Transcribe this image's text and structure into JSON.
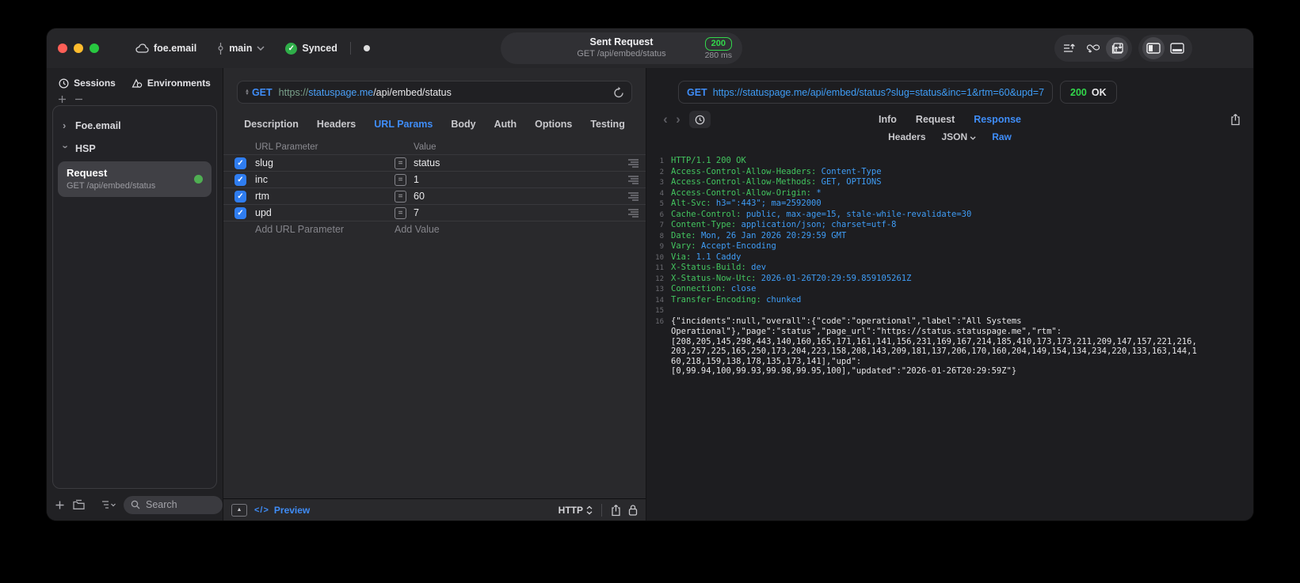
{
  "colors": {
    "accent_blue": "#3f8df8",
    "response_blue": "#3f9df6",
    "header_green": "#43c55f",
    "status_green": "#32d74b",
    "checkbox_blue": "#2f7df0"
  },
  "titlebar": {
    "project": "foe.email",
    "branch": "main",
    "sync_label": "Synced",
    "request_title": "Sent Request",
    "request_subtitle": "GET /api/embed/status",
    "status_code": "200",
    "duration": "280 ms"
  },
  "sidebar": {
    "tabs": [
      {
        "label": "Sessions"
      },
      {
        "label": "Environments"
      }
    ],
    "tree": [
      {
        "label": "Foe.email",
        "expanded": false
      },
      {
        "label": "HSP",
        "expanded": true
      }
    ],
    "selected_request": {
      "title": "Request",
      "subtitle": "GET /api/embed/status"
    },
    "search_placeholder": "Search"
  },
  "request_editor": {
    "method": "GET",
    "url_scheme": "https://",
    "url_host": "statuspage.me",
    "url_path": "/api/embed/status",
    "tabs": [
      "Description",
      "Headers",
      "URL Params",
      "Body",
      "Auth",
      "Options",
      "Testing"
    ],
    "active_tab": "URL Params",
    "params_table": {
      "columns": [
        "URL Parameter",
        "Value"
      ],
      "rows": [
        {
          "name": "slug",
          "value": "status",
          "enabled": true
        },
        {
          "name": "inc",
          "value": "1",
          "enabled": true
        },
        {
          "name": "rtm",
          "value": "60",
          "enabled": true
        },
        {
          "name": "upd",
          "value": "7",
          "enabled": true
        }
      ],
      "add_name_placeholder": "Add URL Parameter",
      "add_value_placeholder": "Add Value"
    },
    "footer": {
      "preview_glyph": "</>",
      "preview_label": "Preview",
      "protocol": "HTTP"
    }
  },
  "response_viewer": {
    "method": "GET",
    "url": "https://statuspage.me/api/embed/status?slug=status&inc=1&rtm=60&upd=7",
    "status_code": "200",
    "status_text": "OK",
    "tabs": [
      "Info",
      "Request",
      "Response"
    ],
    "active_tab": "Response",
    "subtabs": [
      {
        "label": "Headers"
      },
      {
        "label": "JSON",
        "dropdown": true
      },
      {
        "label": "Raw"
      }
    ],
    "active_subtab": "Raw",
    "lines": [
      {
        "n": "1",
        "s": [
          {
            "c": "g",
            "t": "HTTP/1.1 200 OK"
          }
        ]
      },
      {
        "n": "2",
        "s": [
          {
            "c": "g",
            "t": "Access-Control-Allow-Headers: "
          },
          {
            "c": "b",
            "t": "Content-Type"
          }
        ]
      },
      {
        "n": "3",
        "s": [
          {
            "c": "g",
            "t": "Access-Control-Allow-Methods: "
          },
          {
            "c": "b",
            "t": "GET, OPTIONS"
          }
        ]
      },
      {
        "n": "4",
        "s": [
          {
            "c": "g",
            "t": "Access-Control-Allow-Origin: "
          },
          {
            "c": "b",
            "t": "*"
          }
        ]
      },
      {
        "n": "5",
        "s": [
          {
            "c": "g",
            "t": "Alt-Svc: "
          },
          {
            "c": "b",
            "t": "h3=\":443\"; ma=2592000"
          }
        ]
      },
      {
        "n": "6",
        "s": [
          {
            "c": "g",
            "t": "Cache-Control: "
          },
          {
            "c": "b",
            "t": "public, max-age=15, stale-while-revalidate=30"
          }
        ]
      },
      {
        "n": "7",
        "s": [
          {
            "c": "g",
            "t": "Content-Type: "
          },
          {
            "c": "b",
            "t": "application/json; charset=utf-8"
          }
        ]
      },
      {
        "n": "8",
        "s": [
          {
            "c": "g",
            "t": "Date: "
          },
          {
            "c": "b",
            "t": "Mon, 26 Jan 2026 20:29:59 GMT"
          }
        ]
      },
      {
        "n": "9",
        "s": [
          {
            "c": "g",
            "t": "Vary: "
          },
          {
            "c": "b",
            "t": "Accept-Encoding"
          }
        ]
      },
      {
        "n": "10",
        "s": [
          {
            "c": "g",
            "t": "Via: "
          },
          {
            "c": "b",
            "t": "1.1 Caddy"
          }
        ]
      },
      {
        "n": "11",
        "s": [
          {
            "c": "g",
            "t": "X-Status-Build: "
          },
          {
            "c": "b",
            "t": "dev"
          }
        ]
      },
      {
        "n": "12",
        "s": [
          {
            "c": "g",
            "t": "X-Status-Now-Utc: "
          },
          {
            "c": "b",
            "t": "2026-01-26T20:29:59.859105261Z"
          }
        ]
      },
      {
        "n": "13",
        "s": [
          {
            "c": "g",
            "t": "Connection: "
          },
          {
            "c": "b",
            "t": "close"
          }
        ]
      },
      {
        "n": "14",
        "s": [
          {
            "c": "g",
            "t": "Transfer-Encoding: "
          },
          {
            "c": "b",
            "t": "chunked"
          }
        ]
      },
      {
        "n": "15",
        "s": []
      },
      {
        "n": "16",
        "s": [
          {
            "c": "w",
            "t": "{\"incidents\":null,\"overall\":{\"code\":\"operational\",\"label\":\"All Systems"
          }
        ]
      },
      {
        "n": "",
        "s": [
          {
            "c": "w",
            "t": "Operational\"},\"page\":\"status\",\"page_url\":\"https://status.statuspage.me\",\"rtm\":"
          }
        ]
      },
      {
        "n": "",
        "s": [
          {
            "c": "w",
            "t": "[208,205,145,298,443,140,160,165,171,161,141,156,231,169,167,214,185,410,173,173,211,209,147,157,221,216,"
          }
        ]
      },
      {
        "n": "",
        "s": [
          {
            "c": "w",
            "t": "203,257,225,165,250,173,204,223,158,208,143,209,181,137,206,170,160,204,149,154,134,234,220,133,163,144,1"
          }
        ]
      },
      {
        "n": "",
        "s": [
          {
            "c": "w",
            "t": "60,218,159,138,178,135,173,141],\"upd\":"
          }
        ]
      },
      {
        "n": "",
        "s": [
          {
            "c": "w",
            "t": "[0,99.94,100,99.93,99.98,99.95,100],\"updated\":\"2026-01-26T20:29:59Z\"}"
          }
        ]
      }
    ]
  }
}
